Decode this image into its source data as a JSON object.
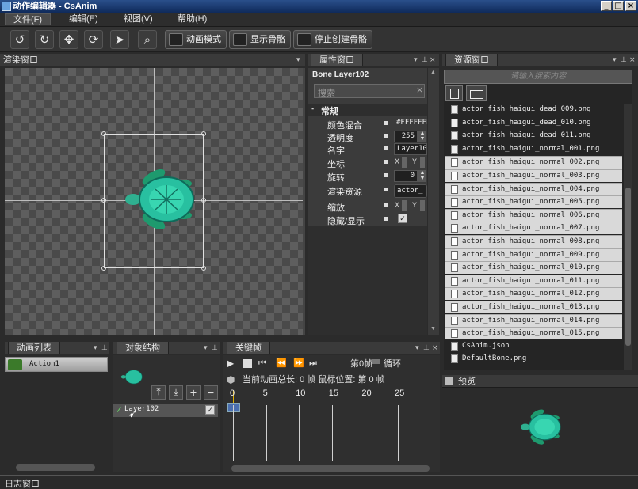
{
  "window": {
    "title": "动作编辑器 - CsAnim"
  },
  "menu": {
    "file": "文件(F)",
    "edit": "编辑(E)",
    "view": "视图(V)",
    "help": "帮助(H)"
  },
  "toolbar": {
    "icons": [
      "rotate-left",
      "rotate-right",
      "move",
      "refresh",
      "select-add",
      "zoom"
    ],
    "anim_mode": "动画模式",
    "show_bones": "显示骨骼",
    "stop_bones": "停止创建骨骼"
  },
  "render": {
    "title": "渲染窗口"
  },
  "properties": {
    "title": "属性窗口",
    "bone_label": "Bone Layer102",
    "search_placeholder": "搜索",
    "section": "常规",
    "rows": [
      {
        "label": "颜色混合",
        "value": "#FFFFFFF"
      },
      {
        "label": "透明度",
        "value": "255"
      },
      {
        "label": "名字",
        "value": "Layer10"
      },
      {
        "label": "坐标",
        "value": ""
      },
      {
        "label": "旋转",
        "value": "0"
      },
      {
        "label": "渲染资源",
        "value": "actor_"
      },
      {
        "label": "缩放",
        "value": ""
      },
      {
        "label": "隐藏/显示",
        "value": "✓"
      }
    ],
    "x_label": "X",
    "y_label": "Y"
  },
  "resources": {
    "title": "资源窗口",
    "hint": "请输入搜索内容",
    "items": [
      {
        "name": "actor_fish_haigui_dead_009.png",
        "sel": false
      },
      {
        "name": "actor_fish_haigui_dead_010.png",
        "sel": false
      },
      {
        "name": "actor_fish_haigui_dead_011.png",
        "sel": false
      },
      {
        "name": "actor_fish_haigui_normal_001.png",
        "sel": false
      },
      {
        "name": "actor_fish_haigui_normal_002.png",
        "sel": true
      },
      {
        "name": "actor_fish_haigui_normal_003.png",
        "sel": true
      },
      {
        "name": "actor_fish_haigui_normal_004.png",
        "sel": true
      },
      {
        "name": "actor_fish_haigui_normal_005.png",
        "sel": true
      },
      {
        "name": "actor_fish_haigui_normal_006.png",
        "sel": true
      },
      {
        "name": "actor_fish_haigui_normal_007.png",
        "sel": true
      },
      {
        "name": "actor_fish_haigui_normal_008.png",
        "sel": true
      },
      {
        "name": "actor_fish_haigui_normal_009.png",
        "sel": true
      },
      {
        "name": "actor_fish_haigui_normal_010.png",
        "sel": true
      },
      {
        "name": "actor_fish_haigui_normal_011.png",
        "sel": true
      },
      {
        "name": "actor_fish_haigui_normal_012.png",
        "sel": true
      },
      {
        "name": "actor_fish_haigui_normal_013.png",
        "sel": true
      },
      {
        "name": "actor_fish_haigui_normal_014.png",
        "sel": true
      },
      {
        "name": "actor_fish_haigui_normal_015.png",
        "sel": true
      },
      {
        "name": "CsAnim.json",
        "sel": false
      },
      {
        "name": "DefaultBone.png",
        "sel": false
      }
    ]
  },
  "preview": {
    "title": "预览"
  },
  "anim_list": {
    "title": "动画列表",
    "items": [
      "Action1"
    ]
  },
  "object_tree": {
    "title": "对象结构",
    "layer": "Layer102"
  },
  "keyframes": {
    "title": "关键帧",
    "frame_label": "第0帧",
    "loop_label": "循环",
    "status": "当前动画总长: 0 帧 鼠标位置: 第 0 帧",
    "ruler": [
      "0",
      "5",
      "10",
      "15",
      "20",
      "25"
    ]
  },
  "log": {
    "title": "日志窗口"
  }
}
